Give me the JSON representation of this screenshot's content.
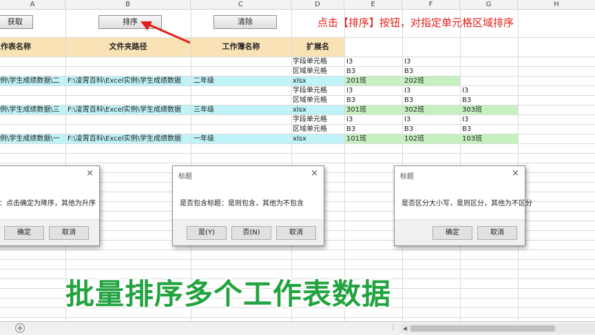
{
  "columns": [
    "A",
    "B",
    "C",
    "D",
    "E",
    "F",
    "G",
    "H"
  ],
  "buttons": {
    "fetch": "获取",
    "sort": "排序",
    "clear": "清除"
  },
  "hint": "点击【排序】按钮，对指定单元格区域排序",
  "headers": {
    "colA": "工作表名称",
    "colB": "文件夹路径",
    "colC": "工作簿名称",
    "colD": "扩展名"
  },
  "rows": {
    "r1": {
      "d": "字段单元格",
      "e": "I3",
      "f": "I3"
    },
    "r2": {
      "d": "区域单元格",
      "e": "B3",
      "f": "B3"
    },
    "r3": {
      "a": "例\\学生成绩数据\\二",
      "b": "F:\\凌霄百科\\Excel实例\\学生成绩数据",
      "c": "二年级",
      "d": "xlsx",
      "e": "201班",
      "f": "202班"
    },
    "r4": {
      "d": "字段单元格",
      "e": "I3",
      "f": "I3",
      "g": "I3"
    },
    "r5": {
      "d": "区域单元格",
      "e": "B3",
      "f": "B3",
      "g": "B3"
    },
    "r6": {
      "a": "例\\学生成绩数据\\三",
      "b": "F:\\凌霄百科\\Excel实例\\学生成绩数据",
      "c": "三年级",
      "d": "xlsx",
      "e": "301班",
      "f": "302班",
      "g": "303班"
    },
    "r7": {
      "d": "字段单元格",
      "e": "I3",
      "f": "I3",
      "g": "I3"
    },
    "r8": {
      "d": "区域单元格",
      "e": "B3",
      "f": "B3",
      "g": "B3"
    },
    "r9": {
      "a": "例\\学生成绩数据\\一",
      "b": "F:\\凌霄百科\\Excel实例\\学生成绩数据",
      "c": "一年级",
      "d": "xlsx",
      "e": "101班",
      "f": "102班",
      "g": "103班"
    }
  },
  "dialog1": {
    "message": "：点击确定为降序，其他为升序",
    "ok": "确定",
    "cancel": "取消",
    "close": "×"
  },
  "dialog2": {
    "title": "标题",
    "message": "是否包含标题：是则包含，其他为不包含",
    "yes": "是(Y)",
    "no": "否(N)",
    "cancel": "取消",
    "close": "×"
  },
  "dialog3": {
    "title": "标题",
    "message": "是否区分大小写，是则区分，其他为不区分",
    "ok": "确定",
    "cancel": "取消",
    "close": "×"
  },
  "caption": "批量排序多个工作表数据",
  "tabbar": {
    "add": "+",
    "dots": "⋮",
    "scroll_left": "◀"
  },
  "colors": {
    "header_fill": "#f9e3b6",
    "cyan_fill": "#bff3f7",
    "green_fill": "#c6f0c0",
    "hint_red": "#e0201b",
    "caption_green": "#22a33f"
  }
}
